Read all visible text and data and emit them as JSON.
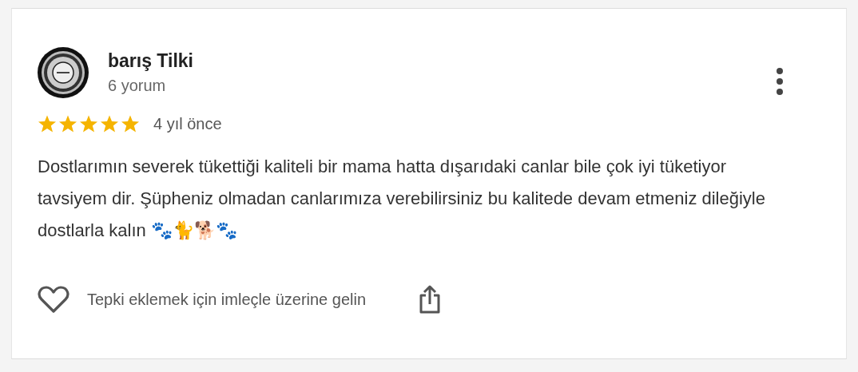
{
  "review": {
    "author": "barış Tilki",
    "review_count": "6 yorum",
    "stars": 5,
    "time": "4 yıl önce",
    "text": "Dostlarımın severek tükettiği kaliteli bir mama hatta dışarıdaki canlar bile çok iyi tüketiyor tavsiyem dir. Şüpheniz olmadan canlarımıza verebilirsiniz bu kalitede devam etmeniz dileğiyle dostlarla kalın 🐾🐈🐕🐾",
    "reaction_hint": "Tepki eklemek için imleçle üzerine gelin"
  }
}
